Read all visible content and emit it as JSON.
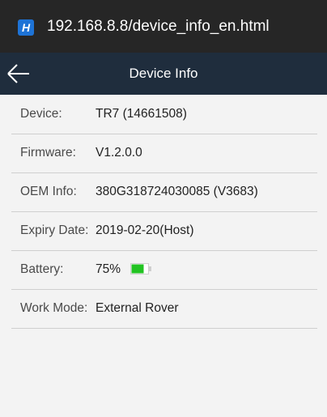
{
  "browser": {
    "url": "192.168.8.8/device_info_en.html",
    "site_icon_letter": "H"
  },
  "header": {
    "title": "Device Info"
  },
  "rows": [
    {
      "label": "Device:",
      "value": "TR7 (14661508)"
    },
    {
      "label": "Firmware:",
      "value": "V1.2.0.0"
    },
    {
      "label": "OEM Info:",
      "value": "380G318724030085 (V3683)"
    },
    {
      "label": "Expiry Date:",
      "value": "2019-02-20(Host)"
    },
    {
      "label": "Battery:",
      "value": "75%",
      "battery_level": 0.75,
      "battery_color": "#22c322"
    },
    {
      "label": "Work Mode:",
      "value": "External Rover"
    }
  ],
  "colors": {
    "header_bg": "#1f2d3d",
    "urlbar_bg": "#262626",
    "page_bg": "#f3f3f3",
    "site_icon": "#1e73d6"
  }
}
